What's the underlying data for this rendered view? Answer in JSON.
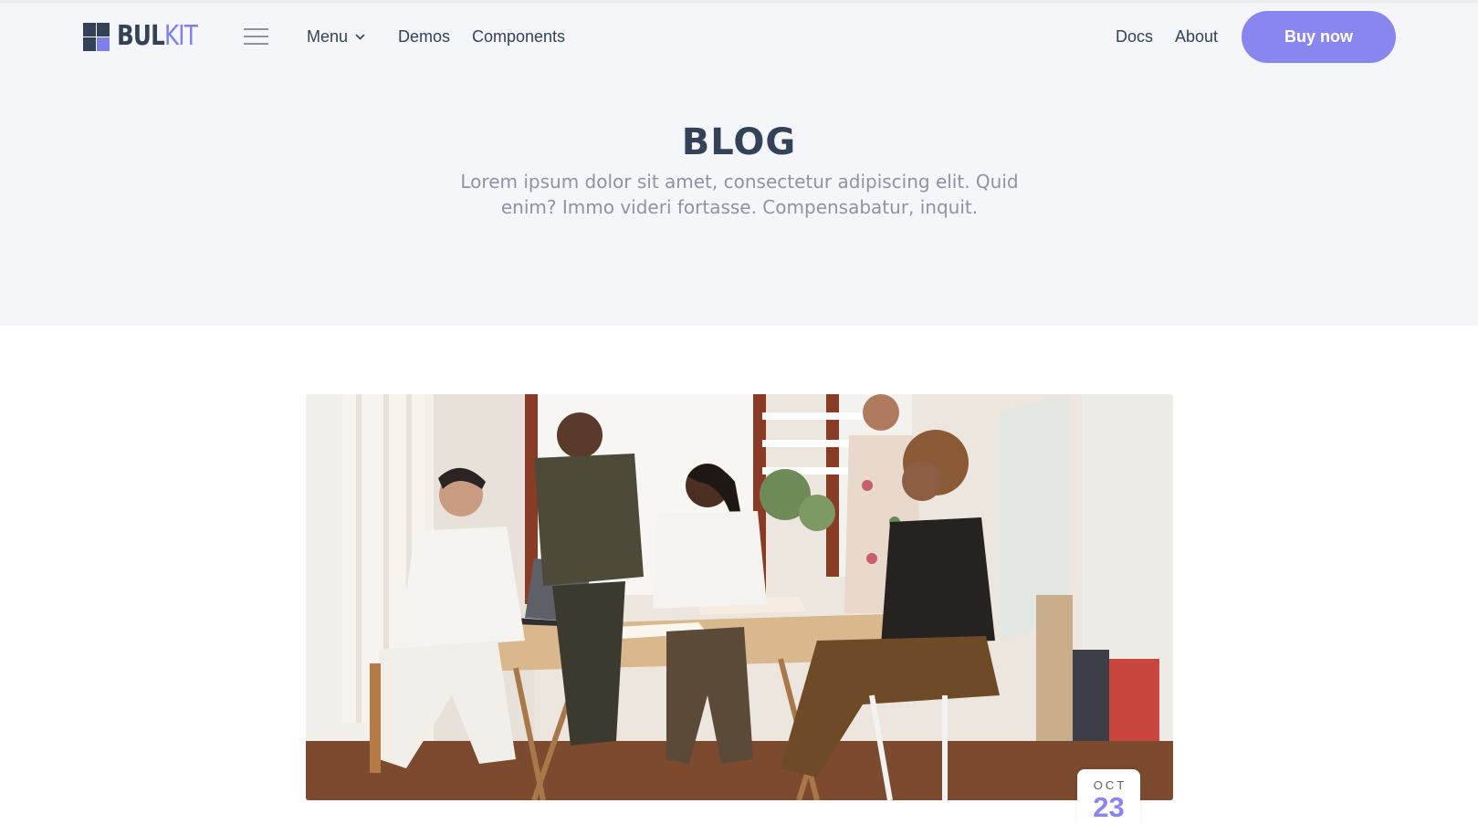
{
  "navbar": {
    "logo": {
      "text_left": "BUL",
      "text_right": "KIT"
    },
    "items": {
      "menu": "Menu",
      "demos": "Demos",
      "components": "Components",
      "docs": "Docs",
      "about": "About"
    },
    "cta_label": "Buy now"
  },
  "hero": {
    "title": "BLOG",
    "subtitle": "Lorem ipsum dolor sit amet, consectetur adipiscing elit. Quid enim? Immo videri fortasse. Compensabatur, inquit."
  },
  "post": {
    "date": {
      "month": "OCT",
      "day": "23"
    }
  },
  "colors": {
    "accent": "#8a86ef",
    "heading": "#344258",
    "hero_background": "#f5f6fa",
    "subtitle": "#8d93a3"
  },
  "icons": {
    "hamburger": "hamburger-menu-icon",
    "menu_caret": "chevron-down-icon"
  }
}
